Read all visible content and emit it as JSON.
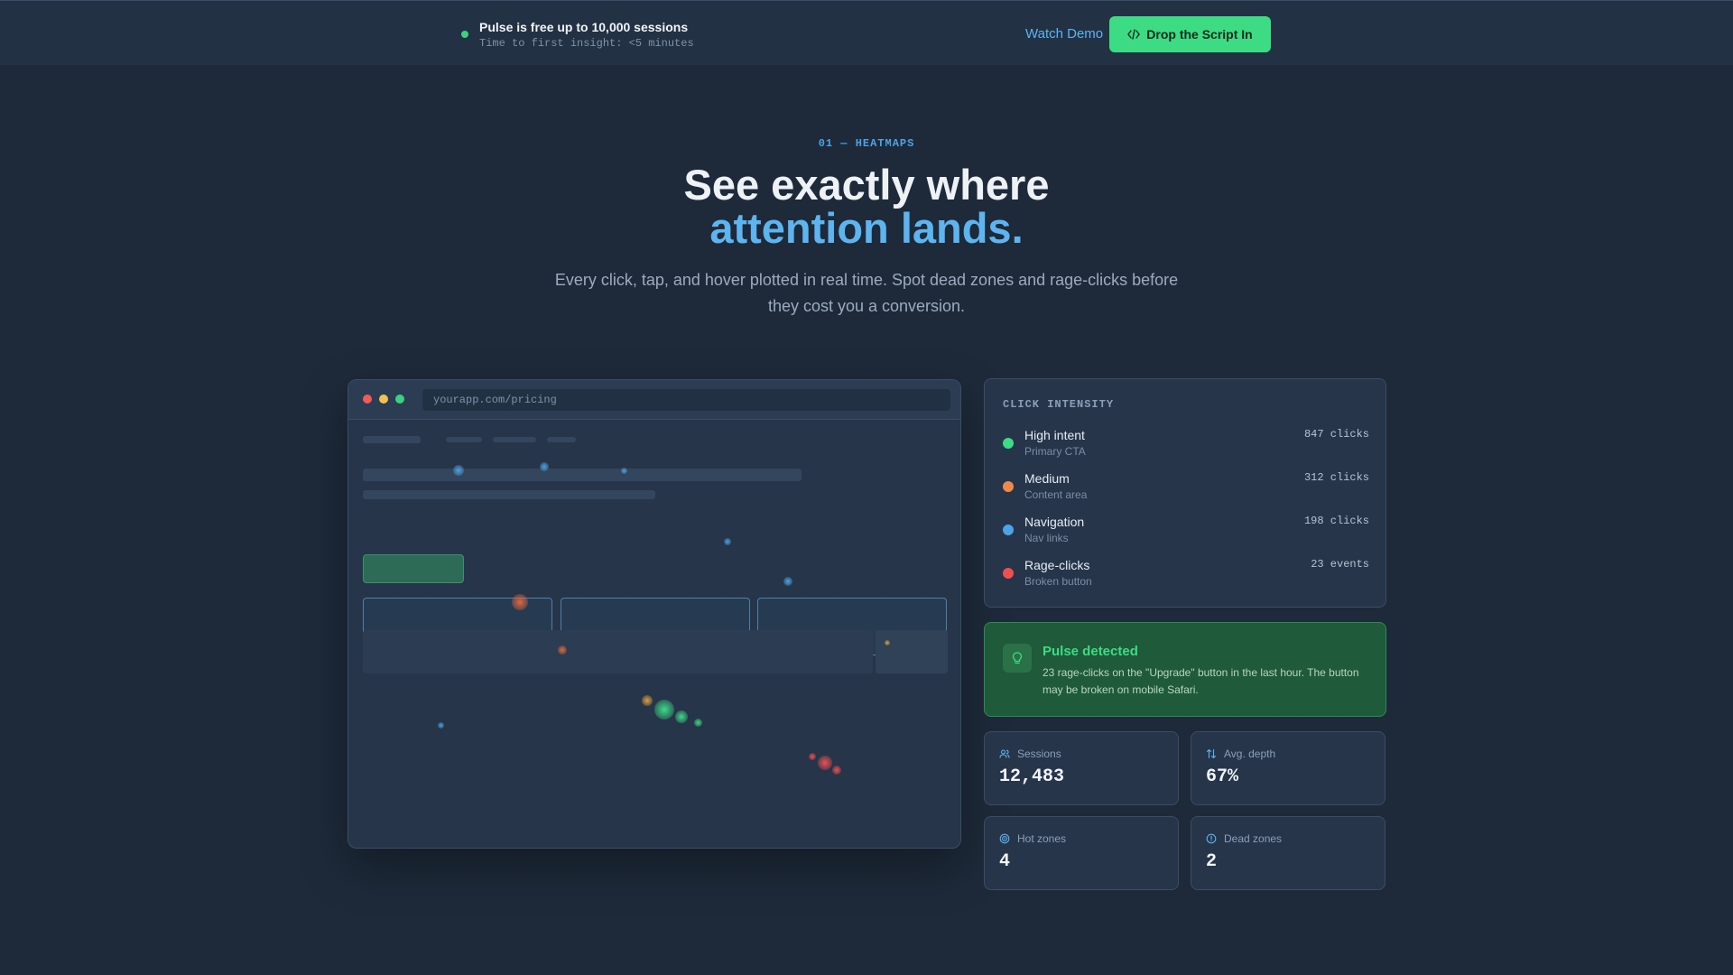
{
  "topbar": {
    "promo_title": "Pulse is free up to 10,000 sessions",
    "promo_sub": "Time to first insight: <5 minutes",
    "watch_demo": "Watch Demo",
    "cta": "Drop the Script In"
  },
  "hero": {
    "eyebrow": "01 — HEATMAPS",
    "title_line1": "See exactly where",
    "title_line2": "attention lands.",
    "subtitle": "Every click, tap, and hover plotted in real time. Spot dead zones and rage-clicks before they cost you a conversion."
  },
  "browser": {
    "url": "yourapp.com/pricing"
  },
  "intensity": {
    "heading": "CLICK INTENSITY",
    "rows": [
      {
        "label": "High intent",
        "sub": "Primary CTA",
        "value": "847 clicks",
        "color": "#3ddc84"
      },
      {
        "label": "Medium",
        "sub": "Content area",
        "value": "312 clicks",
        "color": "#f08a4b"
      },
      {
        "label": "Navigation",
        "sub": "Nav links",
        "value": "198 clicks",
        "color": "#4ea3e4"
      },
      {
        "label": "Rage-clicks",
        "sub": "Broken button",
        "value": "23 events",
        "color": "#ef4f4f"
      }
    ]
  },
  "alert": {
    "title": "Pulse detected",
    "text": "23 rage-clicks on the \"Upgrade\" button in the last hour. The button may be broken on mobile Safari."
  },
  "stats": [
    {
      "label": "Sessions",
      "value": "12,483",
      "icon": "users-icon"
    },
    {
      "label": "Avg. depth",
      "value": "67%",
      "icon": "arrows-updown-icon"
    },
    {
      "label": "Hot zones",
      "value": "4",
      "icon": "target-icon"
    },
    {
      "label": "Dead zones",
      "value": "2",
      "icon": "info-circle-icon"
    }
  ],
  "colors": {
    "accent_green": "#3ddc84",
    "accent_blue": "#5eb4ef",
    "background": "#1e2a3a"
  }
}
